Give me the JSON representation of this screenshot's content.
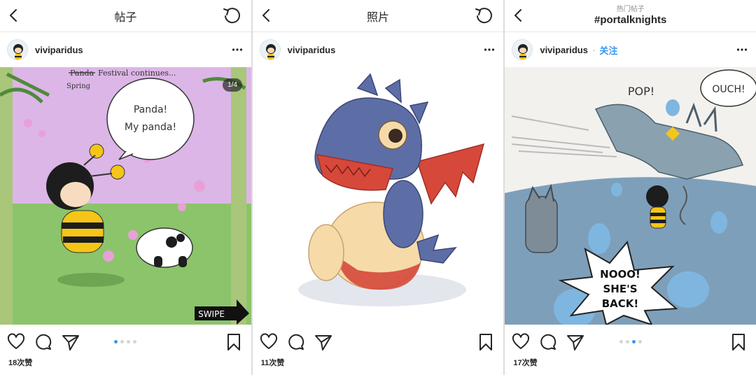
{
  "panels": [
    {
      "header": {
        "title": "帖子"
      },
      "post": {
        "username": "viviparidus",
        "counter": "1/4",
        "likes": "18次赞"
      },
      "image": {
        "caption_top": "Festival continues...",
        "struck_word": "Panda",
        "spring_word": "Spring",
        "bubble_line1": "Panda!",
        "bubble_line2": "My panda!",
        "swipe": "SWIPE"
      }
    },
    {
      "header": {
        "title": "照片"
      },
      "post": {
        "username": "viviparidus",
        "likes": "11次赞"
      }
    },
    {
      "header": {
        "kicker": "热门帖子",
        "hashtag": "#portalknights"
      },
      "post": {
        "username": "viviparidus",
        "separator": "·",
        "follow": "关注",
        "likes": "17次赞"
      },
      "image": {
        "pop": "POP!",
        "ouch": "OUCH!",
        "burst_line1": "NOOO!",
        "burst_line2": "SHE'S",
        "burst_line3": "BACK!"
      }
    }
  ],
  "colors": {
    "accent": "#3897f0",
    "text": "#262626",
    "muted": "#8e8e8e",
    "divider": "#e6e6e6"
  },
  "icons": [
    "back-icon",
    "refresh-icon",
    "more-icon",
    "heart-icon",
    "comment-icon",
    "share-icon",
    "bookmark-icon"
  ]
}
